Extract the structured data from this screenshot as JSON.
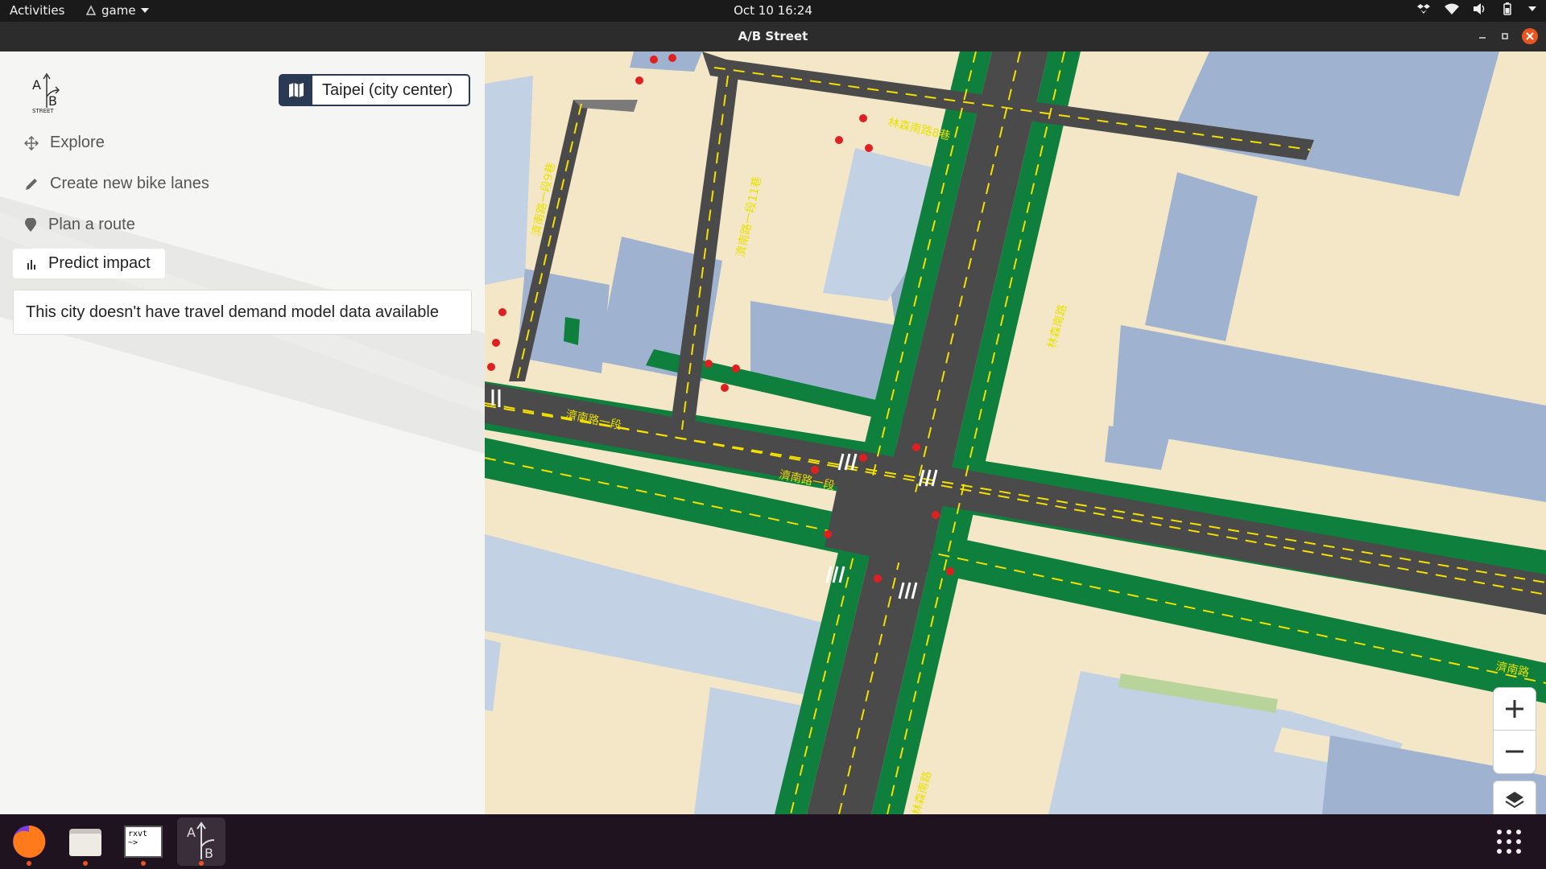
{
  "topbar": {
    "activities": "Activities",
    "app_name": "game",
    "clock": "Oct 10  16:24",
    "tray_icons": [
      "dropbox-icon",
      "wifi-icon",
      "volume-icon",
      "battery-icon",
      "chevron-down-icon"
    ]
  },
  "window": {
    "title": "A/B Street"
  },
  "panel": {
    "logo": {
      "a": "A",
      "b": "B",
      "sub": "STREET"
    },
    "city_button": "Taipei (city center)",
    "menu": [
      {
        "label": "Explore",
        "icon": "move-icon"
      },
      {
        "label": "Create new bike lanes",
        "icon": "pencil-icon"
      },
      {
        "label": "Plan a route",
        "icon": "pin-icon"
      },
      {
        "label": "Predict impact",
        "icon": "bar-chart-icon"
      }
    ],
    "info": "This city doesn't have travel demand model data available"
  },
  "map": {
    "street_labels": [
      "濟南路一段",
      "濟南路一段",
      "林森南路",
      "林森南路8巷",
      "濟南路一段11巷",
      "濟南路一段9巷",
      "濟南路",
      "林森南路"
    ],
    "colors": {
      "ground": "#f4e7c7",
      "road": "#4a4a4a",
      "bike_lane": "#0f7f3d",
      "building": "#9fb3d1",
      "centerline": "#f5e000"
    }
  },
  "dock": {
    "apps": [
      {
        "name": "firefox",
        "label": ""
      },
      {
        "name": "files",
        "label": ""
      },
      {
        "name": "rxvt",
        "label": "rxvt\n~>"
      },
      {
        "name": "abstreet",
        "label": ""
      }
    ]
  }
}
